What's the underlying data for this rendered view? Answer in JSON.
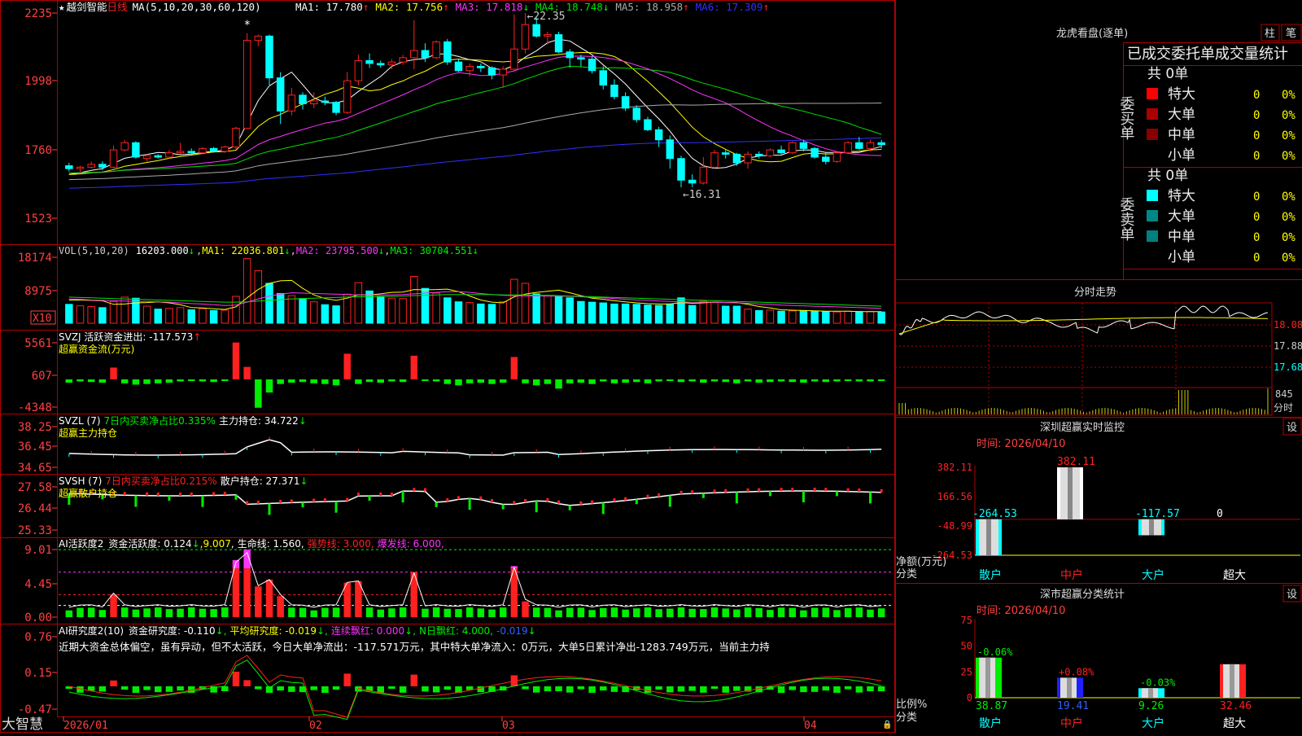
{
  "colors": {
    "up": "#ff2020",
    "down": "#00ffff",
    "frame": "#b00000",
    "ma1": "#ffffff",
    "ma2": "#ffff00",
    "ma3": "#ff33ff",
    "ma4": "#00e000",
    "ma5": "#aaaaaa",
    "ma6": "#3030ff",
    "axis_text": "#ff4040",
    "green": "#00ee00",
    "magenta": "#ff33ff",
    "yellow": "#ffff00",
    "cyan": "#00ffff",
    "white": "#ffffff"
  },
  "stock": {
    "star": "★",
    "name": "越剑智能",
    "period": "日线"
  },
  "ma_legend": {
    "spec": "MA(5,10,20,30,60,120)",
    "items": [
      {
        "label": "MA1: 17.780",
        "arrow": "↑"
      },
      {
        "label": "MA2: 17.756",
        "arrow": "↑"
      },
      {
        "label": "MA3: 17.818",
        "arrow": "↓"
      },
      {
        "label": "MA4: 18.748",
        "arrow": "↓"
      },
      {
        "label": "MA5: 18.958",
        "arrow": "↑"
      },
      {
        "label": "MA6: 17.309",
        "arrow": "↑"
      }
    ]
  },
  "main_axis": {
    "ticks": [
      "2235",
      "1998",
      "1760",
      "1523"
    ],
    "ylim": [
      15.23,
      22.35
    ]
  },
  "annotations": {
    "high": "22.35",
    "low": "16.31",
    "high_prefix": "←",
    "low_prefix": "←",
    "mark": "*"
  },
  "x_axis": {
    "labels": [
      "2026/01",
      "02",
      "03",
      "04"
    ]
  },
  "vol": {
    "title": "VOL(5,10,20)",
    "value": "16203.000",
    "arrow": "↓",
    "items": [
      {
        "label": "MA1: 22036.801",
        "arrow": "↓"
      },
      {
        "label": "MA2: 23795.500",
        "arrow": "↓"
      },
      {
        "label": "MA3: 30704.551",
        "arrow": "↓"
      }
    ],
    "ticks": [
      "18174",
      "8975"
    ],
    "unit": "X10"
  },
  "svzj": {
    "title": "SVZJ  活跃资金进出: -117.573",
    "arrow": "↑",
    "subtitle": "超赢资金流(万元)",
    "ticks": [
      "5561",
      "607",
      "-4348"
    ]
  },
  "svzl": {
    "title": "SVZL (7)",
    "pct": "7日内买卖净占比0.335%",
    "hold": "主力持仓: 34.722",
    "arrow": "↓",
    "subtitle": "超赢主力持仓",
    "ticks": [
      "38.25",
      "36.45",
      "34.65"
    ]
  },
  "svsh": {
    "title": "SVSH (7)",
    "pct": "7日内买卖净占比0.215%",
    "hold": "散户持仓: 27.371",
    "arrow": "↓",
    "subtitle": "超赢散户持仓",
    "ticks": [
      "27.58",
      "26.44",
      "25.33"
    ]
  },
  "ai_active": {
    "title": "AI活跃度2",
    "active": "资金活跃度: 0.124",
    "a1": "↓",
    "v2": "9.007",
    "a2": ",",
    "life": "生命线: 1.560,",
    "strong": "强势线: 3.000,",
    "burst": "爆发线: 6.000,",
    "ticks": [
      "9.01",
      "4.45",
      "0.00"
    ]
  },
  "ai_research": {
    "title": "AI研究度2(10)",
    "r1": "资金研究度: -0.110",
    "a1": "↓,",
    "r2": "平均研究度: -0.019",
    "a2": "↓,",
    "r3": "连续飘红: 0.000",
    "a3": "↓,",
    "r4": "N日飘红: 4.000,",
    "r5": "-0.019",
    "a5": "↓",
    "text": "近期大资金总体偏空，虽有异动，但不太活跃，今日大单净流出：-117.571万元，其中特大单净流入：0万元，大单5日累计净出-1283.749万元，当前主力持",
    "ticks": [
      "0.76",
      "0.15",
      "-0.47"
    ]
  },
  "footer": {
    "brand": "大智慧"
  },
  "lhb": {
    "title": "龙虎看盘(逐单)",
    "btn1": "柱",
    "btn2": "笔",
    "tab_text": "已成交委托单成交量统计",
    "buy_label": "委买单",
    "sell_label": "委卖单",
    "buy_total": "共 0单",
    "sell_total": "共 0单",
    "rows": [
      {
        "label": "特大",
        "count": "0",
        "pct": "0%"
      },
      {
        "label": "大单",
        "count": "0",
        "pct": "0%"
      },
      {
        "label": "中单",
        "count": "0",
        "pct": "0%"
      },
      {
        "label": "小单",
        "count": "0",
        "pct": "0%"
      }
    ],
    "buy_colors": [
      "#ff0000",
      "#aa0000",
      "#880000",
      ""
    ],
    "sell_colors": [
      "#00ffff",
      "#008888",
      "#008080",
      ""
    ]
  },
  "intraday": {
    "title": "分时走势",
    "ticks": [
      "18.08",
      "17.88",
      "17.68"
    ],
    "vol_tick": "845",
    "vol_label": "分时"
  },
  "monitor": {
    "title": "深圳超赢实时监控",
    "btn": "设",
    "date": "时间: 2026/04/10",
    "ticks": [
      "382.11",
      "166.56",
      "-48.99",
      "-264.53"
    ],
    "bars": [
      {
        "label": "散户",
        "value": -264.53,
        "text": "-264.53"
      },
      {
        "label": "中户",
        "value": 382.11,
        "text": "382.11"
      },
      {
        "label": "大户",
        "value": -117.57,
        "text": "-117.57"
      },
      {
        "label": "超大",
        "value": 0,
        "text": "0"
      }
    ],
    "ylim": [
      -264.53,
      382.11
    ],
    "left_label1": "净额(万元)",
    "left_label2": "分类"
  },
  "category": {
    "title": "深市超赢分类统计",
    "btn": "设",
    "date": "时间: 2026/04/10",
    "ticks": [
      "75",
      "50",
      "25",
      "0"
    ],
    "bars": [
      {
        "label": "散户",
        "value": 38.87,
        "delta": "-0.06%"
      },
      {
        "label": "中户",
        "value": 19.41,
        "delta": "+0.08%"
      },
      {
        "label": "大户",
        "value": 9.26,
        "delta": "-0.03%"
      },
      {
        "label": "超大",
        "value": 32.46,
        "delta": ""
      }
    ],
    "ylim": [
      0,
      75
    ],
    "left_label1": "比例%",
    "left_label2": "分类"
  },
  "chart_data": {
    "type": "candlestick",
    "dates_axis": [
      "2026/01",
      "02",
      "03",
      "04"
    ],
    "ohlc": [
      [
        17.05,
        17.15,
        16.85,
        16.95
      ],
      [
        16.95,
        17.05,
        16.8,
        17.0
      ],
      [
        17.0,
        17.2,
        16.95,
        17.1
      ],
      [
        17.1,
        17.2,
        16.9,
        17.0
      ],
      [
        17.0,
        17.75,
        16.95,
        17.6
      ],
      [
        17.6,
        17.95,
        17.55,
        17.85
      ],
      [
        17.85,
        17.9,
        17.3,
        17.35
      ],
      [
        17.3,
        17.45,
        17.2,
        17.4
      ],
      [
        17.4,
        17.45,
        17.3,
        17.35
      ],
      [
        17.35,
        17.6,
        17.3,
        17.5
      ],
      [
        17.5,
        17.85,
        17.45,
        17.55
      ],
      [
        17.55,
        17.65,
        17.4,
        17.5
      ],
      [
        17.5,
        17.7,
        17.45,
        17.65
      ],
      [
        17.65,
        17.7,
        17.5,
        17.55
      ],
      [
        17.55,
        17.75,
        17.5,
        17.7
      ],
      [
        17.7,
        18.4,
        17.6,
        18.35
      ],
      [
        18.35,
        21.65,
        18.35,
        21.4
      ],
      [
        21.4,
        21.6,
        21.2,
        21.55
      ],
      [
        21.55,
        21.6,
        19.8,
        20.1
      ],
      [
        20.1,
        20.3,
        18.5,
        18.95
      ],
      [
        18.95,
        19.75,
        18.8,
        19.5
      ],
      [
        19.5,
        19.6,
        19.0,
        19.2
      ],
      [
        19.2,
        19.6,
        19.05,
        19.3
      ],
      [
        19.3,
        19.45,
        19.15,
        19.25
      ],
      [
        19.25,
        19.3,
        18.8,
        18.9
      ],
      [
        18.9,
        20.3,
        18.85,
        20.0
      ],
      [
        20.0,
        20.9,
        19.85,
        20.7
      ],
      [
        20.7,
        20.95,
        20.45,
        20.6
      ],
      [
        20.6,
        20.7,
        20.45,
        20.55
      ],
      [
        20.55,
        20.75,
        20.4,
        20.65
      ],
      [
        20.65,
        20.9,
        20.55,
        20.8
      ],
      [
        20.8,
        22.1,
        20.4,
        21.05
      ],
      [
        21.05,
        21.3,
        20.65,
        20.8
      ],
      [
        20.8,
        21.4,
        20.75,
        21.35
      ],
      [
        21.35,
        21.45,
        20.55,
        20.65
      ],
      [
        20.65,
        20.75,
        20.3,
        20.35
      ],
      [
        20.35,
        20.6,
        20.15,
        20.5
      ],
      [
        20.5,
        20.6,
        20.3,
        20.45
      ],
      [
        20.45,
        20.5,
        20.05,
        20.2
      ],
      [
        20.2,
        20.5,
        19.75,
        20.4
      ],
      [
        20.4,
        22.3,
        20.35,
        21.1
      ],
      [
        21.1,
        22.35,
        20.95,
        21.95
      ],
      [
        21.95,
        22.2,
        21.5,
        21.55
      ],
      [
        21.55,
        21.7,
        21.25,
        21.6
      ],
      [
        21.6,
        21.7,
        20.95,
        21.0
      ],
      [
        21.0,
        21.1,
        20.45,
        20.8
      ],
      [
        20.8,
        20.9,
        20.5,
        20.75
      ],
      [
        20.75,
        20.85,
        20.25,
        20.35
      ],
      [
        20.35,
        20.5,
        19.7,
        19.85
      ],
      [
        19.85,
        20.05,
        19.35,
        19.45
      ],
      [
        19.45,
        19.6,
        18.95,
        19.05
      ],
      [
        19.05,
        19.15,
        18.55,
        18.65
      ],
      [
        18.65,
        18.75,
        18.25,
        18.3
      ],
      [
        18.3,
        18.4,
        17.7,
        17.95
      ],
      [
        17.95,
        18.1,
        16.95,
        17.3
      ],
      [
        17.3,
        17.4,
        16.3,
        16.55
      ],
      [
        16.55,
        16.75,
        16.31,
        16.45
      ],
      [
        16.45,
        17.35,
        16.4,
        17.0
      ],
      [
        17.0,
        17.6,
        16.95,
        17.5
      ],
      [
        17.5,
        17.6,
        17.3,
        17.45
      ],
      [
        17.45,
        17.5,
        17.05,
        17.15
      ],
      [
        17.15,
        17.55,
        16.95,
        17.45
      ],
      [
        17.45,
        17.55,
        17.3,
        17.4
      ],
      [
        17.4,
        17.65,
        17.35,
        17.6
      ],
      [
        17.6,
        17.75,
        17.45,
        17.5
      ],
      [
        17.5,
        17.9,
        17.45,
        17.85
      ],
      [
        17.85,
        17.95,
        17.55,
        17.65
      ],
      [
        17.65,
        17.7,
        17.3,
        17.35
      ],
      [
        17.35,
        17.5,
        17.1,
        17.2
      ],
      [
        17.2,
        17.55,
        17.15,
        17.5
      ],
      [
        17.5,
        17.9,
        17.45,
        17.85
      ],
      [
        17.85,
        18.05,
        17.6,
        17.65
      ],
      [
        17.65,
        17.95,
        17.55,
        17.85
      ],
      [
        17.85,
        17.95,
        17.65,
        17.78
      ]
    ],
    "volume_x10": [
      5200,
      4800,
      4600,
      4300,
      6000,
      7200,
      6900,
      4700,
      3900,
      4100,
      4300,
      3700,
      4000,
      3500,
      3600,
      7400,
      17800,
      14500,
      11000,
      8200,
      7600,
      6800,
      5900,
      5100,
      4800,
      8000,
      11200,
      8900,
      7400,
      6900,
      6800,
      12900,
      9600,
      8300,
      7000,
      5900,
      5700,
      5300,
      5200,
      5900,
      12100,
      11000,
      8100,
      7500,
      7300,
      7000,
      6000,
      5800,
      5600,
      5300,
      5300,
      5200,
      5000,
      4900,
      5300,
      7000,
      4900,
      6100,
      5700,
      4700,
      4700,
      3900,
      3500,
      3600,
      3300,
      3400,
      3500,
      3300,
      3200,
      3100,
      3300,
      3200,
      3200,
      3100
    ],
    "vol_ma": [
      [
        6400,
        6400,
        6300,
        6200,
        5200,
        5300,
        5600,
        5700,
        5900,
        5600,
        5100,
        4300,
        4200,
        4000,
        3800,
        4500,
        7000,
        9300,
        11000,
        11700,
        11800,
        9600,
        7800,
        6800,
        6300,
        6900,
        7800,
        7800,
        8100,
        8500,
        8600,
        9300,
        9200,
        9300,
        9400,
        8700,
        7500,
        6400,
        5800,
        5600,
        7300,
        8000,
        8500,
        8800,
        9100,
        8400,
        7600,
        6900,
        6600,
        6200,
        5900,
        5600,
        5400,
        5300,
        5300,
        5700,
        5500,
        5600,
        5800,
        5700,
        5700,
        5200,
        4600,
        4200,
        3700,
        3600,
        3500,
        3400,
        3300,
        3300,
        3300,
        3200,
        3200,
        3200
      ],
      [
        6700,
        6600,
        6400,
        6300,
        6200,
        6100,
        6000,
        6000,
        5900,
        5800,
        5600,
        5400,
        5300,
        5100,
        4900,
        5000,
        5800,
        6700,
        7500,
        8000,
        8400,
        8300,
        8200,
        8100,
        8000,
        7900,
        7800,
        7800,
        7800,
        7800,
        7900,
        8100,
        8300,
        8500,
        8700,
        8700,
        8500,
        8200,
        7900,
        7700,
        7600,
        7500,
        7500,
        7500,
        7500,
        7400,
        7300,
        7100,
        7000,
        6800,
        6600,
        6400,
        6300,
        6100,
        6000,
        5900,
        5800,
        5800,
        5800,
        5700,
        5600,
        5500,
        5300,
        5200,
        5000,
        4900,
        4800,
        4700,
        4600,
        4500,
        4400,
        4300,
        4200,
        4100
      ],
      [
        7200,
        7100,
        7000,
        6900,
        6800,
        6700,
        6600,
        6500,
        6400,
        6300,
        6200,
        6100,
        6000,
        5900,
        5800,
        5800,
        5900,
        6100,
        6300,
        6500,
        6700,
        6800,
        6900,
        7000,
        7100,
        7200,
        7300,
        7300,
        7400,
        7400,
        7500,
        7600,
        7700,
        7800,
        7900,
        7900,
        7900,
        7900,
        7900,
        7800,
        7800,
        7800,
        7700,
        7700,
        7600,
        7500,
        7400,
        7300,
        7200,
        7100,
        7000,
        6900,
        6800,
        6700,
        6600,
        6500,
        6400,
        6300,
        6200,
        6100,
        6000,
        5900,
        5800,
        5700,
        5600,
        5500,
        5400,
        5300,
        5200,
        5100,
        5000,
        4900,
        4800,
        4700
      ]
    ],
    "fund_flow": [
      -500,
      -300,
      -400,
      -500,
      1800,
      -600,
      -800,
      -700,
      -600,
      -500,
      -300,
      -200,
      -300,
      -400,
      -200,
      5600,
      1900,
      -4300,
      -2000,
      -700,
      -500,
      -400,
      -600,
      -700,
      -900,
      3900,
      -700,
      -400,
      -500,
      -300,
      -400,
      3600,
      -200,
      -300,
      -700,
      -900,
      -600,
      -500,
      -700,
      -500,
      3400,
      -600,
      -900,
      -700,
      -1400,
      -600,
      -500,
      -700,
      -300,
      -600,
      -500,
      -400,
      -600,
      -300,
      -200,
      -400,
      -300,
      -500,
      -300,
      -400,
      -600,
      -300,
      -500,
      -400,
      -300,
      -400,
      -500,
      -300,
      -400,
      -300,
      -200,
      -300,
      -300,
      -117
    ]
  }
}
